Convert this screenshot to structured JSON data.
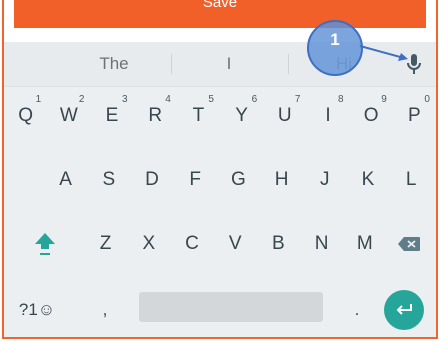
{
  "save_button": {
    "label": "Save"
  },
  "suggestions": [
    "The",
    "I",
    "Hi"
  ],
  "annotation": {
    "label": "1"
  },
  "keyboard": {
    "row1": [
      {
        "key": "Q",
        "hint": "1"
      },
      {
        "key": "W",
        "hint": "2"
      },
      {
        "key": "E",
        "hint": "3"
      },
      {
        "key": "R",
        "hint": "4"
      },
      {
        "key": "T",
        "hint": "5"
      },
      {
        "key": "Y",
        "hint": "6"
      },
      {
        "key": "U",
        "hint": "7"
      },
      {
        "key": "I",
        "hint": "8"
      },
      {
        "key": "O",
        "hint": "9"
      },
      {
        "key": "P",
        "hint": "0"
      }
    ],
    "row2": [
      "A",
      "S",
      "D",
      "F",
      "G",
      "H",
      "J",
      "K",
      "L"
    ],
    "row3": [
      "Z",
      "X",
      "C",
      "V",
      "B",
      "N",
      "M"
    ],
    "symbols_label": "?1☺",
    "comma_label": ",",
    "period_label": "."
  },
  "colors": {
    "accent": "#f2602a",
    "enter": "#26a69a",
    "shift": "#26a69a",
    "annotation": "#5f91d7"
  },
  "icons": [
    "mic-icon",
    "shift-icon",
    "backspace-icon",
    "enter-icon",
    "arrow-icon"
  ]
}
